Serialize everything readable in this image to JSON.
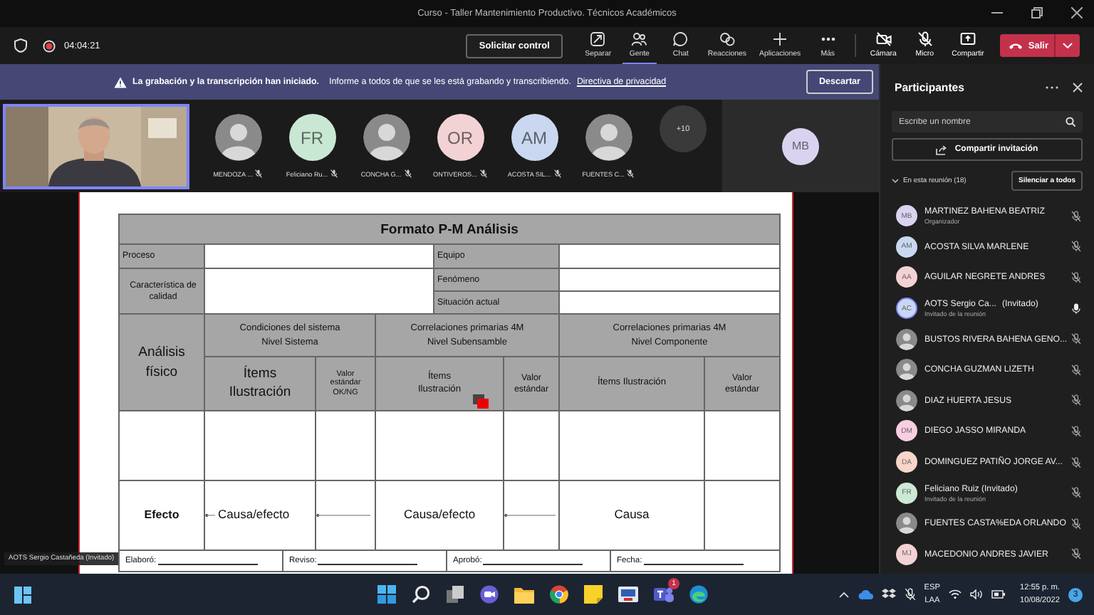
{
  "window": {
    "title": "Curso - Taller Mantenimiento Productivo. Técnicos Académicos"
  },
  "meeting": {
    "time": "04:04:21",
    "recording": true,
    "request_control": "Solicitar control",
    "leave": "Salir"
  },
  "toolbar": [
    {
      "label": "Separar",
      "selected": false
    },
    {
      "label": "Gente",
      "selected": true
    },
    {
      "label": "Chat",
      "selected": false
    },
    {
      "label": "Reacciones",
      "selected": false
    },
    {
      "label": "Aplicaciones",
      "selected": false
    },
    {
      "label": "Más",
      "selected": false
    }
  ],
  "devices": [
    {
      "label": "Cámara",
      "on": false
    },
    {
      "label": "Micro",
      "on": false
    },
    {
      "label": "Compartir"
    }
  ],
  "banner": {
    "title": "La grabación y la transcripción han iniciado.",
    "message": "Informe a todos de que se les está grabando y transcribiendo.",
    "link": "Directiva de privacidad",
    "dismiss": "Descartar"
  },
  "video_strip": [
    {
      "name": "MENDOZA ...",
      "muted": true
    },
    {
      "name": "Feliciano Ru...",
      "kind": "initials",
      "initials": "FR",
      "color": "#c9e8d3",
      "muted": true
    },
    {
      "name": "CONCHA G...",
      "muted": true
    },
    {
      "name": "ONTIVEROS...",
      "kind": "initials",
      "initials": "OR",
      "color": "#f3d2d6",
      "muted": true
    },
    {
      "name": "ACOSTA SIL...",
      "kind": "initials",
      "initials": "AM",
      "color": "#c9d8f0",
      "muted": true
    },
    {
      "name": "FUENTES C...",
      "muted": true
    }
  ],
  "overflow": "+10",
  "spotlight": {
    "initials": "MB",
    "color": "#d9d3f0"
  },
  "presenter": "AOTS Sergio Castañeda (Invitado)",
  "form": {
    "title": "Formato P-M Análisis",
    "fields_left": [
      "Proceso",
      "Característica de calidad"
    ],
    "fields_right": [
      "Equipo",
      "Fenómeno",
      "Situación actual"
    ],
    "row_head": "Análisis físico",
    "groups": [
      {
        "title": "Condiciones del sistema",
        "subtitle": "Nivel Sistema",
        "items": "Ítems Ilustración",
        "value": "Valor estándar OK/NG"
      },
      {
        "title": "Correlaciones primarias 4M",
        "subtitle": "Nivel Subensamble",
        "items": "Ítems Ilustración",
        "value": "Valor estándar"
      },
      {
        "title": "Correlaciones primarias 4M",
        "subtitle": "Nivel Componente",
        "items": "Ítems Ilustración",
        "value": "Valor estándar"
      }
    ],
    "chain": [
      "Efecto",
      "Causa/efecto",
      "Causa/efecto",
      "Causa"
    ],
    "signatures": [
      "Elaboró:",
      "Reviso:",
      "Aprobó:",
      "Fecha:"
    ]
  },
  "participants_panel": {
    "title": "Participantes",
    "search_placeholder": "Escribe un nombre",
    "share": "Compartir invitación",
    "section": "En esta reunión (18)",
    "expanded": true,
    "mute_all": "Silenciar a todos",
    "people": [
      {
        "name": "MARTINEZ BAHENA BEATRIZ",
        "subtitle": "Organizador",
        "kind": "initials",
        "initials": "MB",
        "color": "#d9d3f0",
        "muted": true,
        "active": false
      },
      {
        "name": "ACOSTA SILVA MARLENE",
        "kind": "initials",
        "initials": "AM",
        "color": "#c9d8f0",
        "muted": true,
        "active": false
      },
      {
        "name": "AGUILAR NEGRETE ANDRES",
        "kind": "initials",
        "initials": "AA",
        "color": "#f3d2d6",
        "muted": true,
        "active": false
      },
      {
        "name": "AOTS Sergio Ca...",
        "tag": "(Invitado)",
        "subtitle": "Invitado de la reunión",
        "kind": "initials",
        "initials": "AC",
        "color": "#c9d8f0",
        "muted": false,
        "active": true
      },
      {
        "name": "BUSTOS RIVERA BAHENA GENO...",
        "muted": true,
        "active": false
      },
      {
        "name": "CONCHA GUZMAN LIZETH",
        "muted": true,
        "active": false
      },
      {
        "name": "DIAZ HUERTA JESUS",
        "muted": true,
        "active": false
      },
      {
        "name": "DIEGO JASSO MIRANDA",
        "kind": "initials",
        "initials": "DM",
        "color": "#f6cfe0",
        "muted": true,
        "active": false
      },
      {
        "name": "DOMINGUEZ PATIÑO JORGE AV...",
        "kind": "initials",
        "initials": "DA",
        "color": "#f7d6c9",
        "muted": true,
        "active": false
      },
      {
        "name": "Feliciano Ruiz (Invitado)",
        "subtitle": "Invitado de la reunión",
        "kind": "initials",
        "initials": "FR",
        "color": "#cde8d5",
        "muted": true,
        "active": false
      },
      {
        "name": "FUENTES CASTA%EDA ORLANDO",
        "muted": true,
        "active": false
      },
      {
        "name": "MACEDONIO ANDRES JAVIER",
        "kind": "initials",
        "initials": "MJ",
        "color": "#f3d2d6",
        "muted": true,
        "active": false
      }
    ]
  },
  "taskbar": {
    "teams_badge": "1",
    "language": "ESP",
    "layout": "LAA",
    "time": "12:55 p. m.",
    "date": "10/08/2022",
    "notifications": "3"
  }
}
